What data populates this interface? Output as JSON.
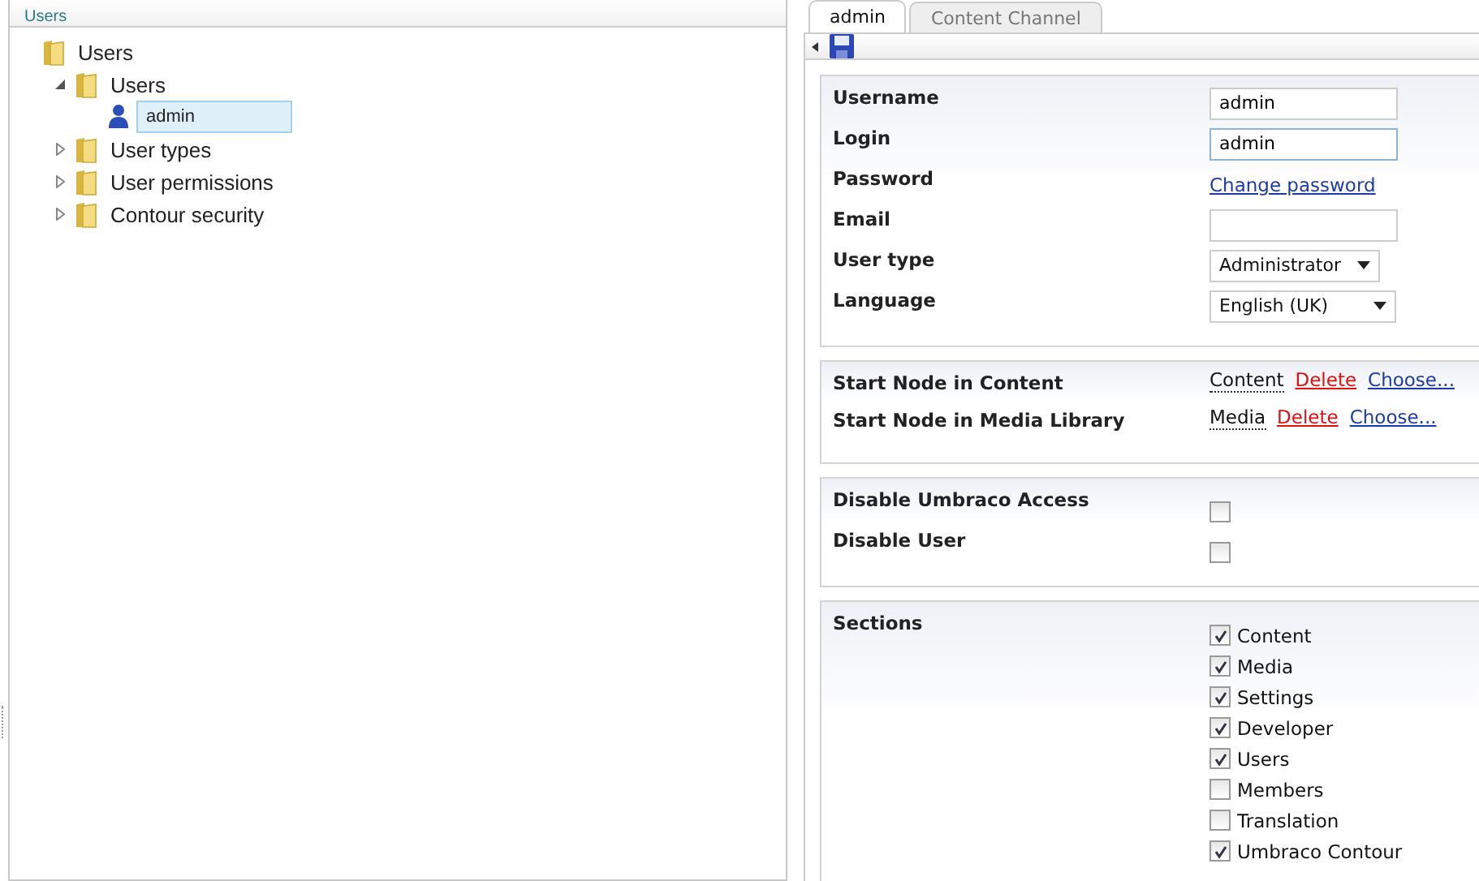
{
  "tree_panel": {
    "title": "Users",
    "tree": [
      {
        "label": "Users",
        "kind": "folder",
        "selected": false,
        "children": [
          {
            "label": "Users",
            "kind": "folder",
            "expanded": true,
            "selected": false,
            "children": [
              {
                "label": "admin",
                "kind": "user",
                "selected": true
              }
            ]
          },
          {
            "label": "User types",
            "kind": "folder",
            "expanded": false,
            "selected": false
          },
          {
            "label": "User permissions",
            "kind": "folder",
            "expanded": false,
            "selected": false
          },
          {
            "label": "Contour security",
            "kind": "folder",
            "expanded": false,
            "selected": false
          }
        ]
      }
    ]
  },
  "tabs": [
    {
      "label": "admin",
      "selected": true
    },
    {
      "label": "Content Channel",
      "selected": false
    }
  ],
  "user_fields": [
    {
      "label": "Username",
      "kind": "text",
      "value": "admin",
      "focused": false
    },
    {
      "label": "Login",
      "kind": "text",
      "value": "admin",
      "focused": true
    },
    {
      "label": "Password",
      "kind": "link",
      "value": "Change password"
    },
    {
      "label": "Email",
      "kind": "text",
      "focused": false
    },
    {
      "label": "User type",
      "kind": "select",
      "value": "Administrator"
    },
    {
      "label": "Language",
      "kind": "select",
      "value": "English (UK)"
    }
  ],
  "start_nodes": [
    {
      "label": "Start Node in Content",
      "value": "Content",
      "delete": "Delete",
      "choose": "Choose..."
    },
    {
      "label": "Start Node in Media Library",
      "value": "Media",
      "delete": "Delete",
      "choose": "Choose..."
    }
  ],
  "access": [
    {
      "label": "Disable Umbraco Access",
      "checked": false
    },
    {
      "label": "Disable User",
      "checked": false
    }
  ],
  "sections": {
    "label": "Sections",
    "items": [
      {
        "label": "Content",
        "checked": true
      },
      {
        "label": "Media",
        "checked": true
      },
      {
        "label": "Settings",
        "checked": true
      },
      {
        "label": "Developer",
        "checked": true
      },
      {
        "label": "Users",
        "checked": true
      },
      {
        "label": "Members",
        "checked": false
      },
      {
        "label": "Translation",
        "checked": false
      },
      {
        "label": "Umbraco Contour",
        "checked": true
      }
    ]
  }
}
